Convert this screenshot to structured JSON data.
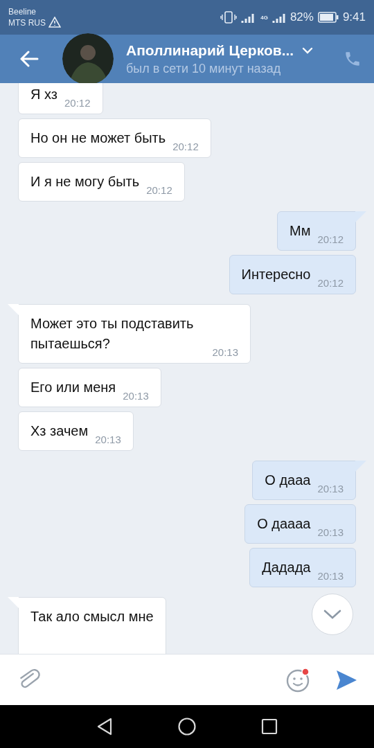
{
  "status_bar": {
    "carrier_1": "Beeline",
    "carrier_2": "MTS RUS",
    "network": "4G",
    "battery": "82%",
    "time": "9:41"
  },
  "header": {
    "name": "Аполлинарий Церков...",
    "status": "был в сети 10 минут назад"
  },
  "messages": [
    {
      "kind": "in",
      "tail": false,
      "text": "Я хз",
      "time": "20:12"
    },
    {
      "kind": "in",
      "tail": false,
      "text": "Но он не может быть",
      "time": "20:12"
    },
    {
      "kind": "in",
      "tail": false,
      "text": "И я не могу быть",
      "time": "20:12"
    },
    {
      "kind": "out",
      "tail": true,
      "text": "Мм",
      "time": "20:12"
    },
    {
      "kind": "out",
      "tail": false,
      "text": "Интересно",
      "time": "20:12"
    },
    {
      "kind": "in",
      "tail": true,
      "text": "Может это ты подставить пытаешься?",
      "time": "20:13"
    },
    {
      "kind": "in",
      "tail": false,
      "text": "Его или меня",
      "time": "20:13"
    },
    {
      "kind": "in",
      "tail": false,
      "text": "Хз зачем",
      "time": "20:13"
    },
    {
      "kind": "out",
      "tail": true,
      "text": "О дааа",
      "time": "20:13"
    },
    {
      "kind": "out",
      "tail": false,
      "text": "О даааа",
      "time": "20:13"
    },
    {
      "kind": "out",
      "tail": false,
      "text": "Дадада",
      "time": "20:13"
    },
    {
      "kind": "in",
      "tail": true,
      "text": "Так ало смысл мне"
    }
  ]
}
